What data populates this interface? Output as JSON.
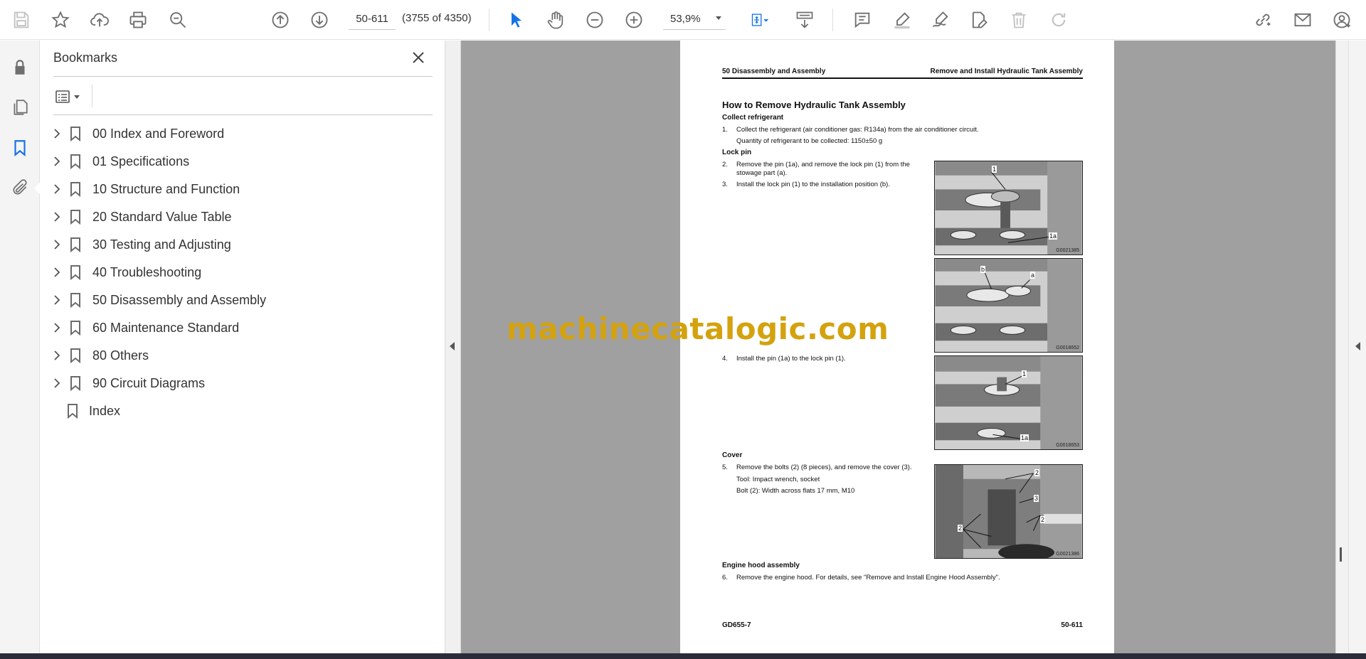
{
  "toolbar": {
    "page_field_value": "50-611",
    "page_count_text": "(3755 of 4350)",
    "zoom_value": "53,9%"
  },
  "bookmarks_panel": {
    "title": "Bookmarks",
    "items": [
      {
        "label": "00 Index and Foreword",
        "has_children": true
      },
      {
        "label": "01 Specifications",
        "has_children": true
      },
      {
        "label": "10 Structure and Function",
        "has_children": true
      },
      {
        "label": "20 Standard Value Table",
        "has_children": true
      },
      {
        "label": "30 Testing and Adjusting",
        "has_children": true
      },
      {
        "label": "40 Troubleshooting",
        "has_children": true
      },
      {
        "label": "50 Disassembly and Assembly",
        "has_children": true
      },
      {
        "label": "60 Maintenance Standard",
        "has_children": true
      },
      {
        "label": "80 Others",
        "has_children": true
      },
      {
        "label": "90 Circuit Diagrams",
        "has_children": true
      },
      {
        "label": "Index",
        "has_children": false
      }
    ]
  },
  "document": {
    "header_left": "50 Disassembly and Assembly",
    "header_right": "Remove and Install Hydraulic Tank Assembly",
    "section_title": "How to Remove Hydraulic Tank Assembly",
    "subheadings": {
      "collect": "Collect refrigerant",
      "lockpin": "Lock pin",
      "cover": "Cover",
      "hood": "Engine hood assembly"
    },
    "steps": {
      "s1": {
        "num": "1.",
        "text": "Collect the refrigerant (air conditioner gas: R134a) from the air conditioner circuit.",
        "sub": "Quantity of refrigerant to be collected: 1150±50 g"
      },
      "s2": {
        "num": "2.",
        "text": "Remove the pin (1a), and remove the lock pin (1) from the stowage part (a)."
      },
      "s3": {
        "num": "3.",
        "text": "Install the lock pin (1) to the installation position (b)."
      },
      "s4": {
        "num": "4.",
        "text": "Install the pin (1a) to the lock pin (1)."
      },
      "s5": {
        "num": "5.",
        "text": "Remove the bolts (2) (8 pieces), and remove the cover (3).",
        "tool": "Tool: Impact wrench, socket",
        "bolt": "Bolt (2): Width across flats 17 mm, M10"
      },
      "s6": {
        "num": "6.",
        "text": "Remove the engine hood. For details, see \"Remove and Install Engine Hood Assembly\"."
      }
    },
    "figures": {
      "f1": {
        "code": "G0021385",
        "callouts": [
          "1",
          "1a"
        ]
      },
      "f2": {
        "code": "G0018652",
        "callouts": [
          "b",
          "a"
        ]
      },
      "f3": {
        "code": "G0018653",
        "callouts": [
          "1",
          "1a"
        ]
      },
      "f4": {
        "code": "G0021386",
        "callouts": [
          "2",
          "3",
          "2",
          "2"
        ]
      }
    },
    "footer_left": "GD655-7",
    "footer_right": "50-611"
  },
  "watermark": "machinecatalogic.com"
}
